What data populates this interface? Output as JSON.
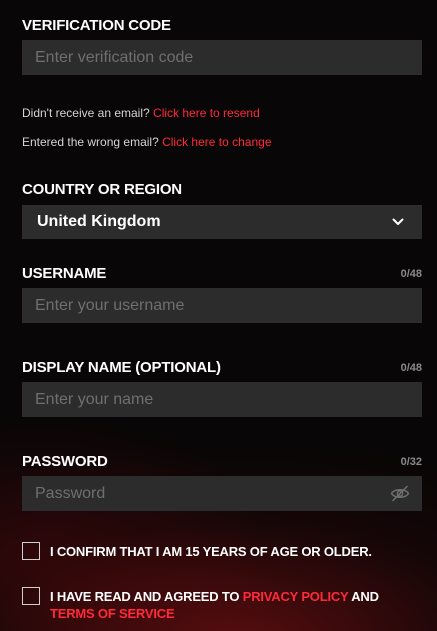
{
  "verification": {
    "label": "VERIFICATION CODE",
    "placeholder": "Enter verification code",
    "value": ""
  },
  "resend": {
    "text": "Didn't receive an email?",
    "link": "Click here to resend"
  },
  "change": {
    "text": "Entered the wrong email?",
    "link": "Click here to change"
  },
  "country": {
    "label": "COUNTRY OR REGION",
    "selected": "United Kingdom",
    "icon": "chevron-down-icon"
  },
  "username": {
    "label": "USERNAME",
    "counter": "0/48",
    "placeholder": "Enter your username",
    "value": ""
  },
  "display_name": {
    "label": "DISPLAY NAME (OPTIONAL)",
    "counter": "0/48",
    "placeholder": "Enter your name",
    "value": ""
  },
  "password": {
    "label": "PASSWORD",
    "counter": "0/32",
    "placeholder": "Password",
    "value": "",
    "icon": "eye-slash-icon"
  },
  "age_confirm": {
    "text": "I CONFIRM THAT I AM 15 YEARS OF AGE OR OLDER.",
    "checked": false
  },
  "agreement": {
    "prefix": "I HAVE READ AND AGREED TO ",
    "privacy_link": "PRIVACY POLICY",
    "middle": " AND ",
    "terms_link": "TERMS OF SERVICE",
    "checked": false
  },
  "colors": {
    "accent": "#ff2a3a",
    "field_bg": "#2c2c2c",
    "background": "#080606"
  }
}
